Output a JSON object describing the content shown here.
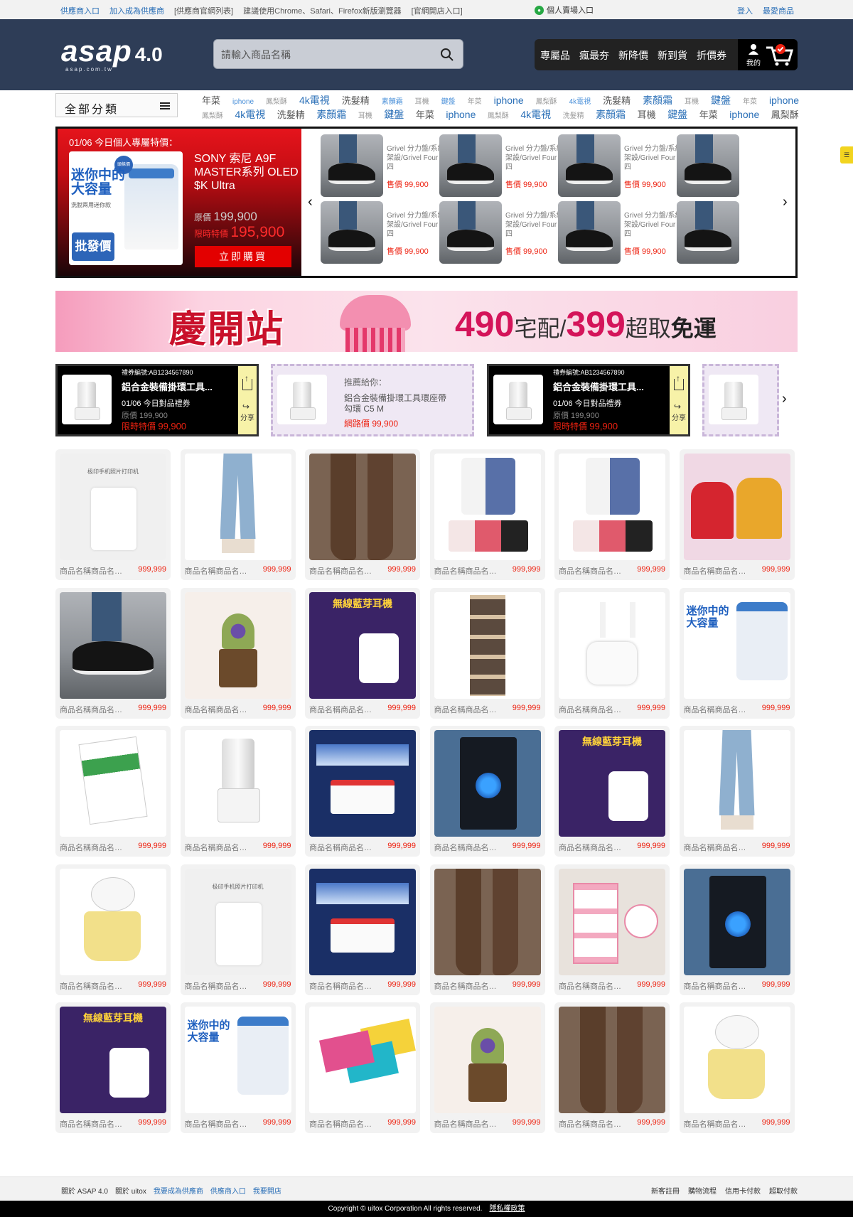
{
  "topbar": {
    "left_links": [
      "供應商入口",
      "加入成為供應商",
      "[供應商官網列表]",
      "建議使用Chrome、Safari、Firefox新版瀏覽器",
      "[官網開店入口]"
    ],
    "center_link": "個人賣場入口",
    "center_icon": "person-circle-icon",
    "login": "登入",
    "favorites": "最愛商品"
  },
  "header": {
    "logo_main": "asap",
    "logo_version": "4.0",
    "logo_sub": "asap.com.tw",
    "search_placeholder": "請輸入商品名稱",
    "nav": [
      "專屬品",
      "瘋最夯",
      "新降價",
      "新到貨",
      "折價券"
    ],
    "mine_label": "我的"
  },
  "category": {
    "button_label": "全部分類",
    "tags_row1": [
      {
        "t": "年菜",
        "s": "md"
      },
      {
        "t": "iphone",
        "s": "blue-sm"
      },
      {
        "t": "鳳梨酥",
        "s": "sm"
      },
      {
        "t": "4k電視",
        "s": "lg"
      },
      {
        "t": "洗髮精",
        "s": "md"
      },
      {
        "t": "素顏霜",
        "s": "blue-sm"
      },
      {
        "t": "耳機",
        "s": "sm"
      },
      {
        "t": "鍵盤",
        "s": "blue-sm"
      },
      {
        "t": "年菜",
        "s": "sm"
      },
      {
        "t": "iphone",
        "s": "lg"
      },
      {
        "t": "鳳梨酥",
        "s": "sm"
      },
      {
        "t": "4k電視",
        "s": "blue-sm"
      },
      {
        "t": "洗髮精",
        "s": "md"
      },
      {
        "t": "素顏霜",
        "s": "lg"
      },
      {
        "t": "耳機",
        "s": "sm"
      },
      {
        "t": "鍵盤",
        "s": "lg"
      },
      {
        "t": "年菜",
        "s": "sm"
      },
      {
        "t": "iphone",
        "s": "lg"
      }
    ],
    "tags_row2": [
      {
        "t": "鳳梨酥",
        "s": "sm"
      },
      {
        "t": "4k電視",
        "s": "lg"
      },
      {
        "t": "洗髮精",
        "s": "md"
      },
      {
        "t": "素顏霜",
        "s": "lg"
      },
      {
        "t": "耳機",
        "s": "sm"
      },
      {
        "t": "鍵盤",
        "s": "lg"
      },
      {
        "t": "年菜",
        "s": "md"
      },
      {
        "t": "iphone",
        "s": "lg"
      },
      {
        "t": "鳳梨酥",
        "s": "sm"
      },
      {
        "t": "4k電視",
        "s": "lg"
      },
      {
        "t": "洗髮精",
        "s": "sm"
      },
      {
        "t": "素顏霜",
        "s": "lg"
      },
      {
        "t": "耳機",
        "s": "md"
      },
      {
        "t": "鍵盤",
        "s": "lg"
      },
      {
        "t": "年菜",
        "s": "md"
      },
      {
        "t": "iphone",
        "s": "lg"
      },
      {
        "t": "鳳梨酥",
        "s": "md"
      }
    ]
  },
  "flash": {
    "date_label": "01/06 今日個人專屬特價：",
    "featured": {
      "img_text1": "迷你中的大容量",
      "img_text2": "洗脫兩用迷你款",
      "img_tag": "批發價",
      "img_badge": "頭條價",
      "name": "SONY 索尼 A9F MASTER系列 OLED $K Ultra",
      "orig_label": "原價",
      "orig_price": "199,900",
      "sale_label": "限時特價",
      "sale_price": "195,900",
      "buy_label": "立即購買"
    },
    "items": [
      {
        "name": "Grivel 分力盤/系統架設/Grivel Four 四",
        "price": "售價 99,900"
      },
      {
        "name": "Grivel 分力盤/系統架設/Grivel Four 四",
        "price": "售價 99,900"
      },
      {
        "name": "Grivel 分力盤/系統架設/Grivel Four 四",
        "price": "售價 99,900"
      },
      {
        "name": "",
        "price": ""
      },
      {
        "name": "Grivel 分力盤/系統架設/Grivel Four 四",
        "price": "售價 99,900"
      },
      {
        "name": "Grivel 分力盤/系統架設/Grivel Four 四",
        "price": "售價 99,900"
      },
      {
        "name": "Grivel 分力盤/系統架設/Grivel Four 四",
        "price": "售價 99,900"
      },
      {
        "name": "",
        "price": ""
      }
    ]
  },
  "banner": {
    "title": "慶開站",
    "num1": "490",
    "txt1": "宅配/",
    "num2": "399",
    "txt2": "超取",
    "txt3": "免運"
  },
  "coupons": [
    {
      "type": "dark",
      "code": "禮券編號:AB1234567890",
      "title": "鋁合金裝備掛環工具...",
      "desc": "01/06 今日對品禮券",
      "orig": "原價 199,900",
      "sale_label": "限時特價",
      "sale_price": "99,900",
      "share": "分享"
    },
    {
      "type": "light",
      "rec": "推薦給你：",
      "title": "鋁合金裝備掛環工具環座帶勾環 C5 M",
      "net": "網路價 99,900"
    },
    {
      "type": "dark",
      "code": "禮券編號:AB1234567890",
      "title": "鋁合金裝備掛環工具...",
      "desc": "01/06 今日對品禮券",
      "orig": "原價 199,900",
      "sale_label": "限時特價",
      "sale_price": "99,900",
      "share": "分享"
    },
    {
      "type": "light",
      "rec": "",
      "title": "",
      "net": ""
    }
  ],
  "products": [
    {
      "art": "printer",
      "name": "商品名稱商品名稱商品名稱",
      "price": "999,999"
    },
    {
      "art": "jeans",
      "name": "商品名稱商品名稱商品名稱",
      "price": "999,999"
    },
    {
      "art": "boots",
      "name": "商品名稱商品名稱商品名稱",
      "price": "999,999"
    },
    {
      "art": "printerbox",
      "name": "商品名稱商品名稱商品名稱",
      "price": "999,999"
    },
    {
      "art": "printerbox blue",
      "name": "商品名稱商品名稱商品名稱",
      "price": "999,999"
    },
    {
      "art": "hoodie",
      "name": "商品名稱商品名稱商品名稱",
      "price": "999,999"
    },
    {
      "art": "shoe",
      "name": "商品名稱商品名稱商品名稱",
      "price": "999,999"
    },
    {
      "art": "plant",
      "name": "商品名稱商品名稱商品名稱",
      "price": "999,999"
    },
    {
      "art": "earbud",
      "name": "商品名稱商品名稱商品名稱",
      "price": "999,999"
    },
    {
      "art": "shelf",
      "name": "商品名稱商品名稱商品名稱",
      "price": "999,999"
    },
    {
      "art": "airpods",
      "name": "商品名稱商品名稱商品名稱",
      "price": "999,999"
    },
    {
      "art": "washer",
      "name": "商品名稱商品名稱商品名稱",
      "price": "999,999"
    },
    {
      "art": "instax",
      "name": "商品名稱商品名稱商品名稱",
      "price": "999,999"
    },
    {
      "art": "blender",
      "name": "商品名稱商品名稱商品名稱",
      "price": "999,999"
    },
    {
      "art": "projector",
      "name": "商品名稱商品名稱商品名稱",
      "price": "999,999"
    },
    {
      "art": "pc",
      "name": "商品名稱商品名稱商品名稱",
      "price": "999,999"
    },
    {
      "art": "earbud",
      "name": "商品名稱商品名稱商品名稱",
      "price": "999,999"
    },
    {
      "art": "jeans",
      "name": "商品名稱商品名稱商品名稱",
      "price": "999,999"
    },
    {
      "art": "yogurt",
      "name": "商品名稱商品名稱商品名稱",
      "price": "999,999"
    },
    {
      "art": "printer",
      "name": "商品名稱商品名稱商品名稱",
      "price": "999,999"
    },
    {
      "art": "projector",
      "name": "商品名稱商品名稱商品名稱",
      "price": "999,999"
    },
    {
      "art": "boots",
      "name": "商品名稱商品名稱商品名稱",
      "price": "999,999"
    },
    {
      "art": "cart",
      "name": "商品名稱商品名稱商品名稱",
      "price": "999,999"
    },
    {
      "art": "pc",
      "name": "商品名稱商品名稱商品名稱",
      "price": "999,999"
    },
    {
      "art": "earbud",
      "name": "商品名稱商品名稱商品名稱",
      "price": "999,999"
    },
    {
      "art": "washer",
      "name": "商品名稱商品名稱商品名稱",
      "price": "999,999"
    },
    {
      "art": "powerbank",
      "name": "商品名稱商品名稱商品名稱",
      "price": "999,999"
    },
    {
      "art": "plant",
      "name": "商品名稱商品名稱商品名稱",
      "price": "999,999"
    },
    {
      "art": "boots",
      "name": "商品名稱商品名稱商品名稱",
      "price": "999,999"
    },
    {
      "art": "yogurt",
      "name": "商品名稱商品名稱商品名稱",
      "price": "999,999"
    }
  ],
  "footer": {
    "left": [
      "關於 ASAP 4.0",
      "關於 uitox",
      "我要成為供應商",
      "供應商入口",
      "我要開店"
    ],
    "right": [
      "新客註冊",
      "購物流程",
      "信用卡付款",
      "超取付款"
    ],
    "copyright": "Copyright © uitox Corporation All rights reserved.",
    "privacy": "隱私權政策"
  },
  "colors": {
    "header_bg": "#2e3d57",
    "link": "#2a6fb7",
    "price_red": "#e21111",
    "flash_red": "#e5141c"
  }
}
